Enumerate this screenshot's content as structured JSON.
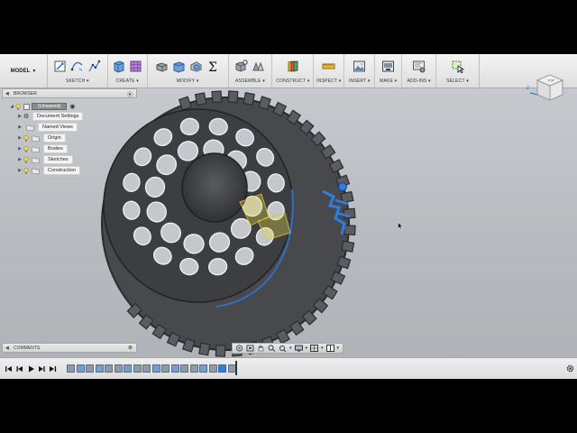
{
  "toolbar": {
    "workspace": "MODEL",
    "groups": [
      {
        "label": "SKETCH ▾"
      },
      {
        "label": "CREATE ▾"
      },
      {
        "label": "MODIFY ▾"
      },
      {
        "label": "ASSEMBLE ▾"
      },
      {
        "label": "CONSTRUCT ▾"
      },
      {
        "label": "INSPECT ▾"
      },
      {
        "label": "INSERT ▾"
      },
      {
        "label": "MAKE ▾"
      },
      {
        "label": "ADD-INS ▾"
      },
      {
        "label": "SELECT ▾"
      }
    ]
  },
  "browser": {
    "title": "BROWSER",
    "root": "(Unsaved)",
    "items": [
      {
        "label": "Document Settings"
      },
      {
        "label": "Named Views"
      },
      {
        "label": "Origin"
      },
      {
        "label": "Bodies"
      },
      {
        "label": "Sketches"
      },
      {
        "label": "Construction"
      }
    ]
  },
  "viewcube": {
    "face": "TOP"
  },
  "comments": {
    "title": "COMMENTS"
  },
  "colors": {
    "accent_blue": "#1a6fd6",
    "gizmo_blue": "#2f7de0",
    "selection_yellow": "#e8d84a",
    "wheel_dark": "#3f4043"
  }
}
